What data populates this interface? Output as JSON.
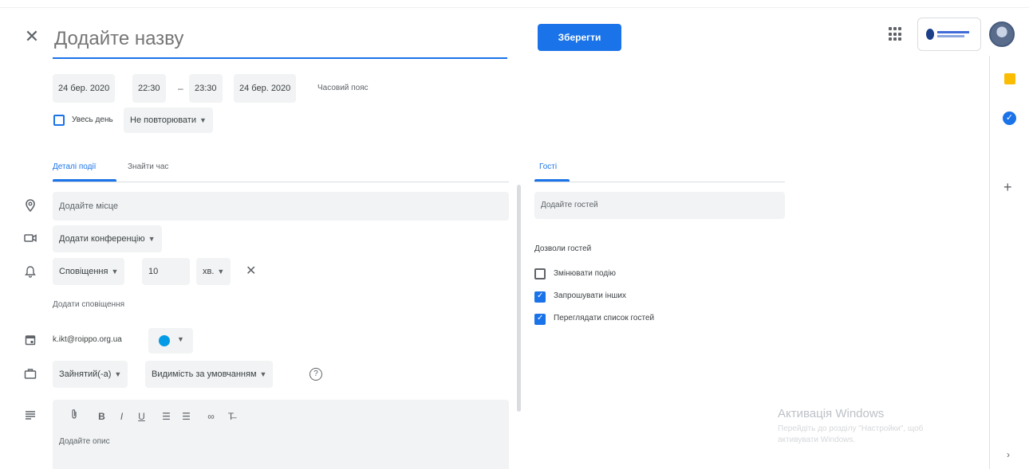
{
  "header": {
    "title_placeholder": "Додайте назву",
    "save_label": "Зберегти"
  },
  "datetime": {
    "start_date": "24 бер. 2020",
    "start_time": "22:30",
    "separator": "–",
    "end_time": "23:30",
    "end_date": "24 бер. 2020",
    "timezone": "Часовий пояс",
    "all_day_label": "Увесь день",
    "all_day_checked": false,
    "repeat": "Не повторювати"
  },
  "tabs": {
    "details": "Деталі події",
    "find_time": "Знайти час",
    "guests": "Гості"
  },
  "details": {
    "location_placeholder": "Додайте місце",
    "conference": "Додати конференцію",
    "notification_type": "Сповіщення",
    "notification_value": "10",
    "notification_unit": "хв.",
    "add_notification": "Додати сповіщення",
    "calendar_email": "k.ikt@roippo.org.ua",
    "calendar_color": "#039be5",
    "busy_status": "Зайнятий(-а)",
    "visibility": "Видимість за умовчанням",
    "description_placeholder": "Додайте опис"
  },
  "guests": {
    "input_placeholder": "Додайте гостей",
    "permissions_title": "Дозволи гостей",
    "permissions": [
      {
        "label": "Змінювати подію",
        "checked": false
      },
      {
        "label": "Запрошувати інших",
        "checked": true
      },
      {
        "label": "Переглядати список гостей",
        "checked": true
      }
    ]
  },
  "watermark": {
    "title": "Активація Windows",
    "subtitle": "Перейдіть до розділу \"Настройки\", щоб",
    "subtitle2": "активувати Windows."
  },
  "icons": {
    "close": "close-icon",
    "apps": "apps-grid-icon",
    "location": "location-pin-icon",
    "video": "video-camera-icon",
    "bell": "bell-icon",
    "calendar": "calendar-icon",
    "briefcase": "briefcase-icon",
    "description": "description-lines-icon"
  },
  "colors": {
    "accent": "#1a73e8",
    "keep": "#fbbc04"
  }
}
